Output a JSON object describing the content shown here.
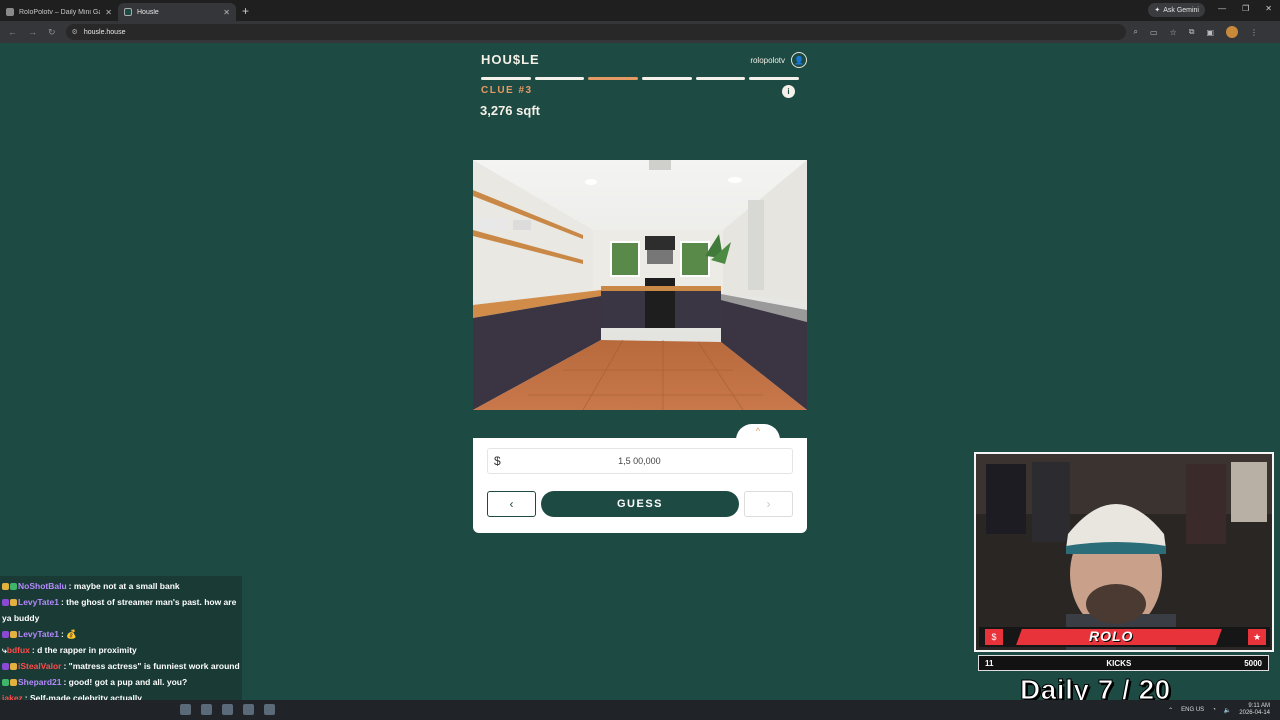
{
  "browser": {
    "tabs": [
      {
        "title": "RoloPolotv – Daily Mini Game |",
        "active": false
      },
      {
        "title": "Housle",
        "active": true
      }
    ],
    "new_tab": "+",
    "ask_gemini": "Ask Gemini",
    "url": "housle.house"
  },
  "game": {
    "logo": "HOU$LE",
    "username": "rolopolotv",
    "progress_total": 6,
    "progress_current_index": 2,
    "clue_title": "CLUE #3",
    "clue_value": "3,276 sqft",
    "currency_symbol": "$",
    "price_value": "1,5 00,000",
    "guess_label": "GUESS",
    "prev_symbol": "‹",
    "next_symbol": "›",
    "collapse_symbol": "^",
    "info_symbol": "i"
  },
  "chat": {
    "messages": [
      {
        "name": "NoShotBalu",
        "name_color": "#b48aff",
        "text": ": maybe not at a small bank"
      },
      {
        "name": "LevyTate1",
        "name_color": "#b48aff",
        "text": ": the ghost of streamer man's past. how are ya buddy"
      },
      {
        "name": "LevyTate1",
        "name_color": "#b48aff",
        "text": ":"
      },
      {
        "name": "bdfux",
        "name_color": "#ff4b4b",
        "text": ": d the rapper in proximity"
      },
      {
        "name": "iStealValor",
        "name_color": "#ff4b4b",
        "text": ": \"matress actress\" is funniest work around"
      },
      {
        "name": "Shepard21",
        "name_color": "#b48aff",
        "text": ": good! got a pup and all. you?"
      },
      {
        "name": "jakez",
        "name_color": "#ff4b4b",
        "text": ": Self-made celebrity actually"
      }
    ]
  },
  "overlay": {
    "brand": "ROLO",
    "stat_left": "11",
    "stat_label": "KICKS",
    "stat_right": "5000",
    "daily_text": "Daily  7 / 20"
  },
  "taskbar": {
    "time": "9:11 AM",
    "date": "2026-04-14",
    "lang": "ENG US"
  }
}
